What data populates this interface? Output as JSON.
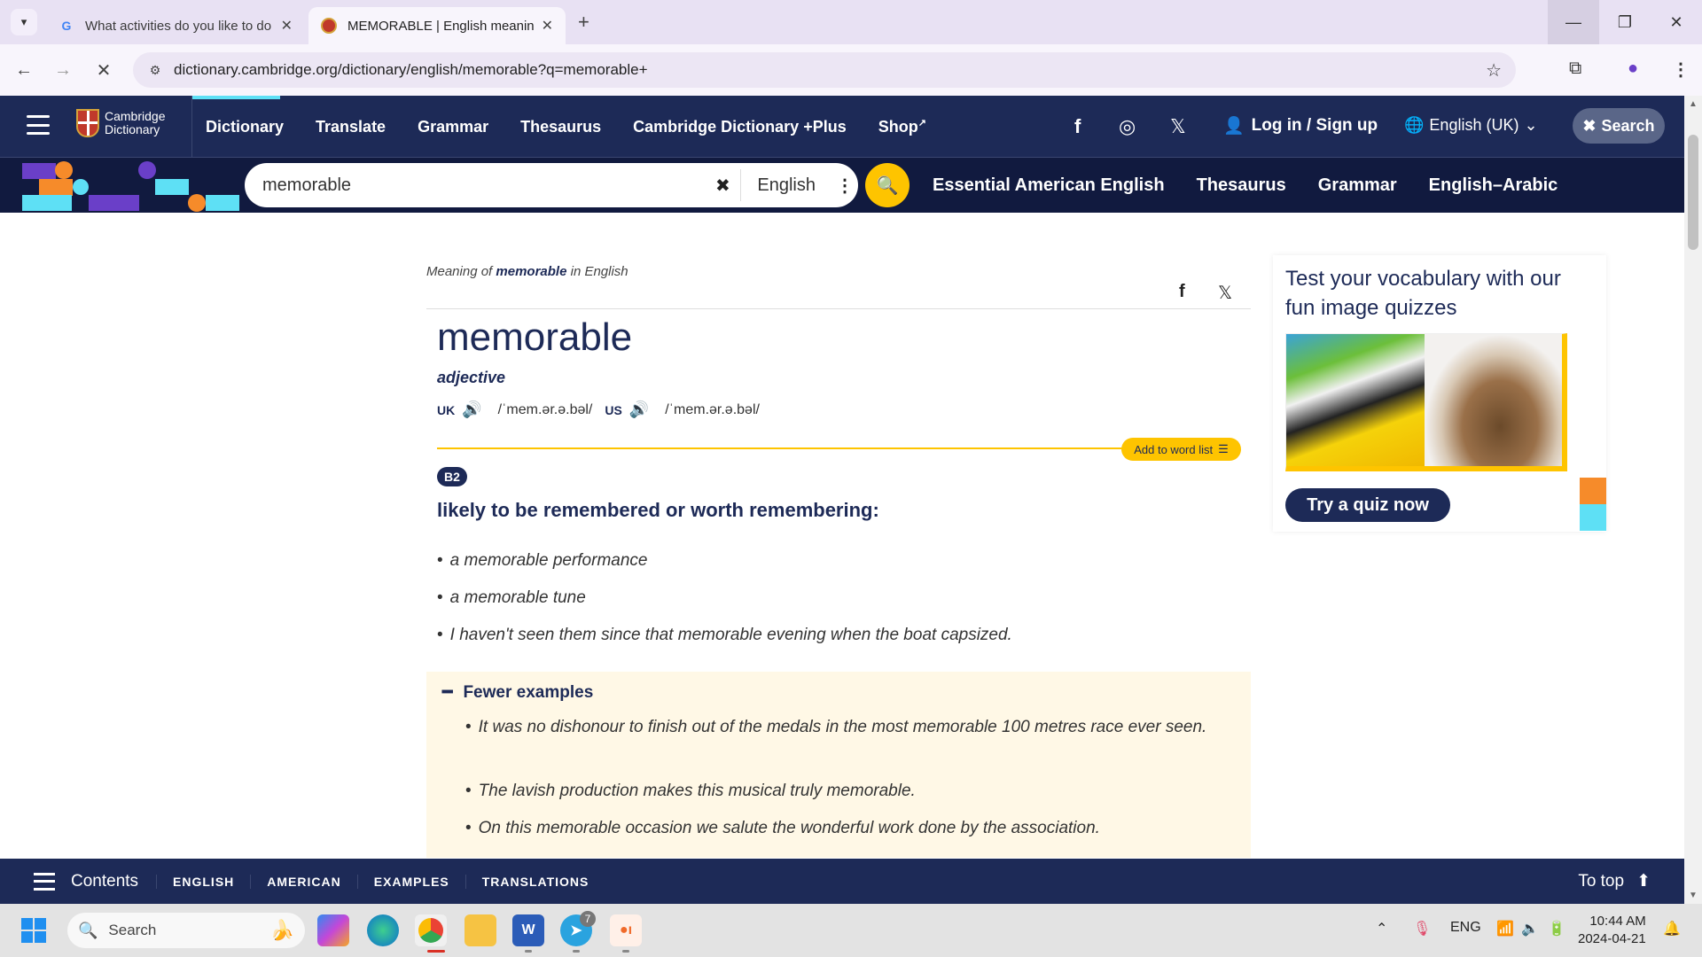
{
  "browser": {
    "tabs": [
      {
        "title": "What activities do you like to do",
        "favicon": "google-icon",
        "active": false
      },
      {
        "title": "MEMORABLE | English meaning",
        "favicon": "cambridge-icon",
        "active": true
      }
    ],
    "url": "dictionary.cambridge.org/dictionary/english/memorable?q=memorable+",
    "new_tab_label": "+"
  },
  "header": {
    "logo_text_line1": "Cambridge",
    "logo_text_line2": "Dictionary",
    "nav": [
      "Dictionary",
      "Translate",
      "Grammar",
      "Thesaurus",
      "Cambridge Dictionary +Plus",
      "Shop"
    ],
    "login_label": "Log in / Sign up",
    "language_label": "English (UK)",
    "search_toggle_label": "Search"
  },
  "search": {
    "query": "memorable",
    "dictionary_label": "English"
  },
  "subnav": [
    "Essential American English",
    "Thesaurus",
    "Grammar",
    "English–Arabic"
  ],
  "entry": {
    "breadcrumb_prefix": "Meaning of",
    "breadcrumb_word": "memorable",
    "breadcrumb_suffix": "in English",
    "headword": "memorable",
    "part_of_speech": "adjective",
    "uk_label": "UK",
    "uk_ipa": "/ˈmem.ər.ə.bəl/",
    "us_label": "US",
    "us_ipa": "/ˈmem.ər.ə.bəl/",
    "add_to_word_list": "Add to word list",
    "level": "B2",
    "definition": "likely to be remembered or worth remembering:",
    "examples": [
      "a memorable performance",
      "a memorable tune",
      "I haven't seen them since that memorable evening when the boat capsized."
    ],
    "more_examples_toggle": "Fewer examples",
    "more_examples": [
      "It was no dishonour to finish out of the medals in the most memorable 100 metres race ever seen.",
      "The lavish production makes this musical truly memorable.",
      "On this memorable occasion we salute the wonderful work done by the association."
    ]
  },
  "sidebar": {
    "quiz_title": "Test your vocabulary with our fun image quizzes",
    "quiz_button": "Try a quiz now"
  },
  "content_bar": {
    "contents_label": "Contents",
    "sections": [
      "ENGLISH",
      "AMERICAN",
      "EXAMPLES",
      "TRANSLATIONS"
    ],
    "to_top_label": "To top"
  },
  "taskbar": {
    "search_placeholder": "Search",
    "apps": [
      "copilot-icon",
      "edge-icon",
      "chrome-icon",
      "file-explorer-icon",
      "word-icon",
      "telegram-icon",
      "app-icon"
    ],
    "telegram_badge": "7",
    "language": "ENG",
    "time": "10:44 AM",
    "date": "2024-04-21"
  },
  "colors": {
    "brand_navy": "#1d2a57",
    "brand_dark": "#111a3f",
    "accent_yellow": "#fec400",
    "accent_cyan": "#5ee0f5",
    "accent_orange": "#f68b2a",
    "accent_purple": "#6a3fc8",
    "examples_bg": "#fff8e6"
  }
}
